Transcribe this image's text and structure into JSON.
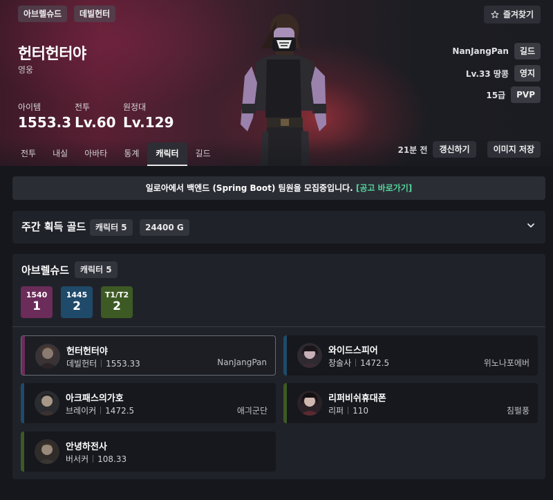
{
  "header": {
    "tags": [
      "아브렐슈드",
      "데빌헌터"
    ],
    "favorite_label": "즐겨찾기",
    "character_name": "헌터헌터야",
    "title": "영웅",
    "stats": [
      {
        "label": "아이템",
        "value": "1553.3"
      },
      {
        "label": "전투",
        "value": "Lv.60"
      },
      {
        "label": "원정대",
        "value": "Lv.129"
      }
    ],
    "right_info": [
      {
        "text": "NanJangPan",
        "button": "길드"
      },
      {
        "text": "Lv.33 땅콩",
        "button": "영지"
      },
      {
        "text": "15급",
        "button": "PVP"
      }
    ],
    "tabs": [
      "전투",
      "내실",
      "아바타",
      "통계",
      "캐릭터",
      "길드"
    ],
    "active_tab": "캐릭터",
    "updated": "21분 전",
    "refresh_label": "갱신하기",
    "save_image_label": "이미지 저장"
  },
  "banner": {
    "text": "일로아에서 백엔드 (Spring Boot) 팀원을 모집중입니다.",
    "link": "[공고 바로가기]"
  },
  "weekly_gold": {
    "title": "주간 획득 골드",
    "character_count": "캐릭터 5",
    "gold": "24400 G"
  },
  "server": {
    "name": "아브렐슈드",
    "character_count": "캐릭터 5",
    "level_groups": [
      {
        "label": "1540",
        "count": "1",
        "color": "#6b2c5a"
      },
      {
        "label": "1445",
        "count": "2",
        "color": "#1f4a6a"
      },
      {
        "label": "T1/T2",
        "count": "2",
        "color": "#3d5a24"
      }
    ],
    "characters": [
      {
        "name": "헌터헌터야",
        "class": "데빌헌터",
        "item_level": "1553.33",
        "guild": "NanJangPan",
        "bar_color": "#6b2c5a",
        "selected": true
      },
      {
        "name": "와이드스피어",
        "class": "창술사",
        "item_level": "1472.5",
        "guild": "위노나포에버",
        "bar_color": "#1f4a6a",
        "selected": false
      },
      {
        "name": "아크패스의가호",
        "class": "브레이커",
        "item_level": "1472.5",
        "guild": "애긔군단",
        "bar_color": "#1f4a6a",
        "selected": false
      },
      {
        "name": "리퍼비쉬휴대폰",
        "class": "리퍼",
        "item_level": "110",
        "guild": "침펄풍",
        "bar_color": "#3d5a24",
        "selected": false
      },
      {
        "name": "안녕하전사",
        "class": "버서커",
        "item_level": "108.33",
        "guild": "",
        "bar_color": "#3d5a24",
        "selected": false
      }
    ]
  }
}
